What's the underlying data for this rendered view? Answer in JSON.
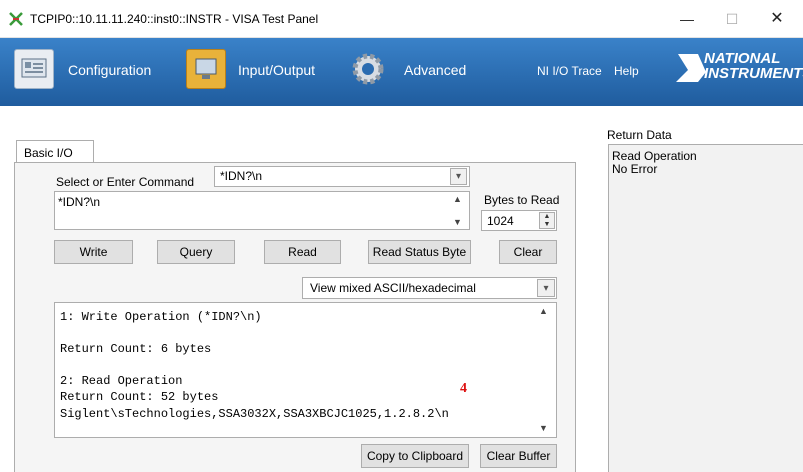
{
  "window": {
    "title": "TCPIP0::10.11.11.240::inst0::INSTR - VISA Test Panel",
    "minimize": "—",
    "maximize": "☐",
    "close": "✕"
  },
  "toolbar": {
    "configuration": "Configuration",
    "input_output": "Input/Output",
    "advanced": "Advanced",
    "ni_io_trace": "NI I/O Trace",
    "help": "Help",
    "logo_line1": "NATIONAL",
    "logo_line2": "INSTRUMENTS",
    "brand_color": "#2b6cb0"
  },
  "tabs": [
    {
      "label": "Basic I/O",
      "active": true
    }
  ],
  "command": {
    "label": "Select or Enter Command",
    "combo_value": "*IDN?\\n",
    "text_value": "*IDN?\\n"
  },
  "bytes_to_read": {
    "label": "Bytes to Read",
    "value": "1024"
  },
  "buttons": {
    "write": "Write",
    "query": "Query",
    "read": "Read",
    "read_status_byte": "Read Status Byte",
    "clear": "Clear",
    "copy_to_clipboard": "Copy to Clipboard",
    "clear_buffer": "Clear Buffer"
  },
  "view_mode": {
    "selected": "View mixed ASCII/hexadecimal"
  },
  "output_buffer": {
    "lines": [
      "1: Write Operation (*IDN?\\n)",
      "Return Count: 6 bytes",
      "2: Read Operation",
      "Return Count: 52 bytes",
      "Siglent\\sTechnologies,SSA3032X,SSA3XBCJC1025,1.2.8.2\\n"
    ],
    "annotation": "4"
  },
  "return_data": {
    "label": "Return Data",
    "lines": [
      "Read Operation",
      "No Error"
    ]
  }
}
